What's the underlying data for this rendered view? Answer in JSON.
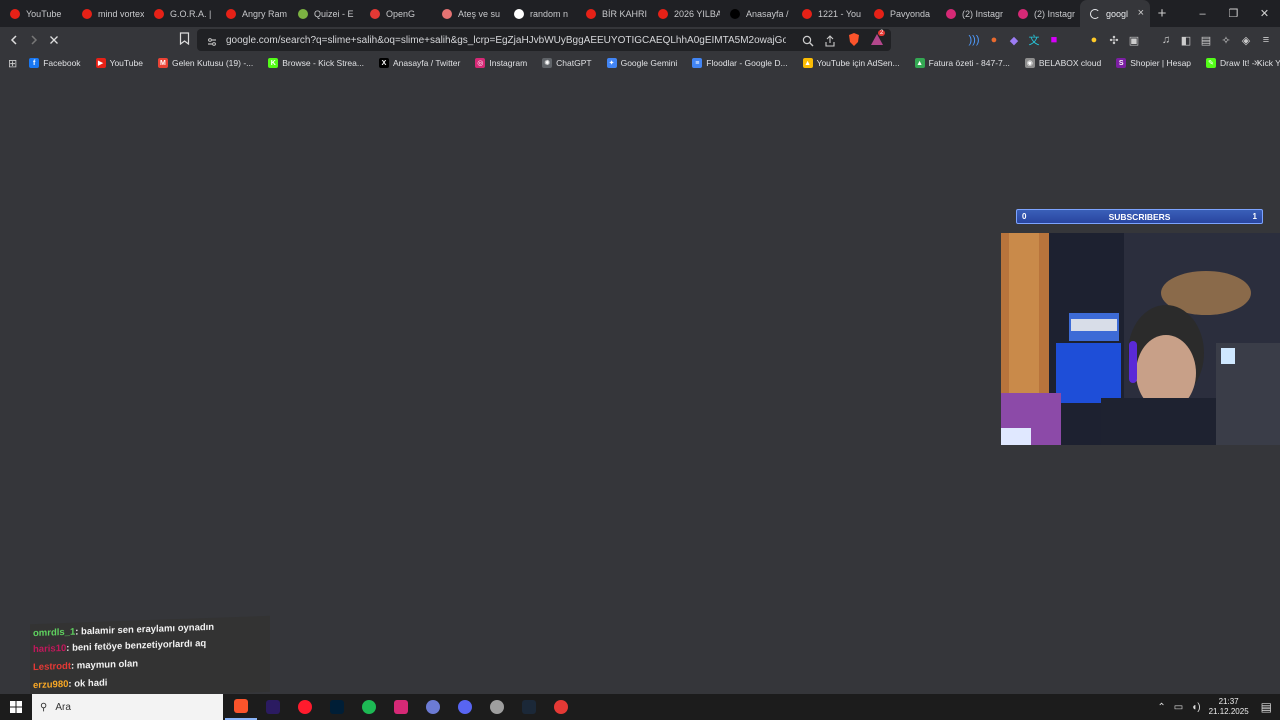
{
  "browser": {
    "tabs": [
      {
        "label": "YouTube",
        "color": "#e62117"
      },
      {
        "label": "mind vortex",
        "color": "#e62117"
      },
      {
        "label": "G.O.R.A. |",
        "color": "#e62117"
      },
      {
        "label": "Angry Ram",
        "color": "#e62117"
      },
      {
        "label": "Quizei - E",
        "color": "#7cb342"
      },
      {
        "label": "OpenG",
        "color": "#e53935"
      },
      {
        "label": "Ateş ve su",
        "color": "#e57373"
      },
      {
        "label": "random n",
        "color": "#ffffff"
      },
      {
        "label": "BİR KAHRI",
        "color": "#e62117"
      },
      {
        "label": "2026 YILBA",
        "color": "#e62117"
      },
      {
        "label": "Anasayfa /",
        "color": "#000000"
      },
      {
        "label": "1221 - You",
        "color": "#e62117"
      },
      {
        "label": "Pavyonda",
        "color": "#e62117"
      },
      {
        "label": "(2) Instagr",
        "color": "#d62976"
      },
      {
        "label": "(2) Instagr",
        "color": "#d62976"
      }
    ],
    "active_tab": {
      "label": "googl",
      "close": "×"
    },
    "new_tab": "+",
    "window_controls": {
      "minimize": "–",
      "restore": "❐",
      "close": "✕"
    },
    "url": "google.com/search?q=slime+salih&oq=slime+salih&gs_lcrp=EgZjaHJvbWUyBggAEEUYOTIGCAEQLhhA0gEIMTA5M2owajGoAgCwAgA...",
    "shields_badge": "2",
    "bookmarks": [
      {
        "label": "Facebook",
        "color": "#1877f2",
        "glyph": "f"
      },
      {
        "label": "YouTube",
        "color": "#e62117",
        "glyph": "▶"
      },
      {
        "label": "Gelen Kutusu (19) -...",
        "color": "#ea4335",
        "glyph": "M"
      },
      {
        "label": "Browse - Kick Strea...",
        "color": "#53fc18",
        "glyph": "K"
      },
      {
        "label": "Anasayfa / Twitter",
        "color": "#000000",
        "glyph": "X"
      },
      {
        "label": "Instagram",
        "color": "#d62976",
        "glyph": "◎"
      },
      {
        "label": "ChatGPT",
        "color": "#5f6368",
        "glyph": "✺"
      },
      {
        "label": "Google Gemini",
        "color": "#4285f4",
        "glyph": "✦"
      },
      {
        "label": "Floodlar - Google D...",
        "color": "#4285f4",
        "glyph": "≡"
      },
      {
        "label": "YouTube için AdSen...",
        "color": "#fbbc04",
        "glyph": "▲"
      },
      {
        "label": "Fatura özeti - 847-7...",
        "color": "#34a853",
        "glyph": "▲"
      },
      {
        "label": "BELABOX cloud",
        "color": "#8e8e8e",
        "glyph": "◉"
      },
      {
        "label": "Shopier | Hesap",
        "color": "#7b1fa2",
        "glyph": "S"
      },
      {
        "label": "Draw It! - Kick Yayın...",
        "color": "#53fc18",
        "glyph": "✎"
      }
    ],
    "bookmarks_more": "»"
  },
  "stream_overlay": {
    "subscribers": {
      "left": "0",
      "label": "SUBSCRIBERS",
      "right": "1"
    },
    "chat": [
      {
        "user": "omrdls_1",
        "text": ": balamir sen eraylamı oynadın",
        "color": "#5fd35f"
      },
      {
        "user": "haris10",
        "text": ": beni fetöye benzetiyorlardı aq",
        "color": "#c2185b"
      },
      {
        "user": "Lestrodt",
        "text": ": maymun olan",
        "color": "#e53935"
      },
      {
        "user": "erzu980",
        "text": ": ok hadi",
        "color": "#f9a825"
      }
    ]
  },
  "taskbar": {
    "search_placeholder": "Ara",
    "apps": [
      {
        "name": "brave",
        "color": "#fb542b"
      },
      {
        "name": "premiere",
        "color": "#2b1b61"
      },
      {
        "name": "opera",
        "color": "#ff1b2d"
      },
      {
        "name": "photoshop",
        "color": "#001e36"
      },
      {
        "name": "spotify",
        "color": "#1db954"
      },
      {
        "name": "instagram",
        "color": "#d62976"
      },
      {
        "name": "obs",
        "color": "#6c7bd4"
      },
      {
        "name": "discord",
        "color": "#5865f2"
      },
      {
        "name": "steam-overlay",
        "color": "#9e9e9e"
      },
      {
        "name": "steam",
        "color": "#1b2838"
      },
      {
        "name": "acrobat",
        "color": "#e53935"
      }
    ],
    "time": "21:37",
    "date": "21.12.2025"
  }
}
